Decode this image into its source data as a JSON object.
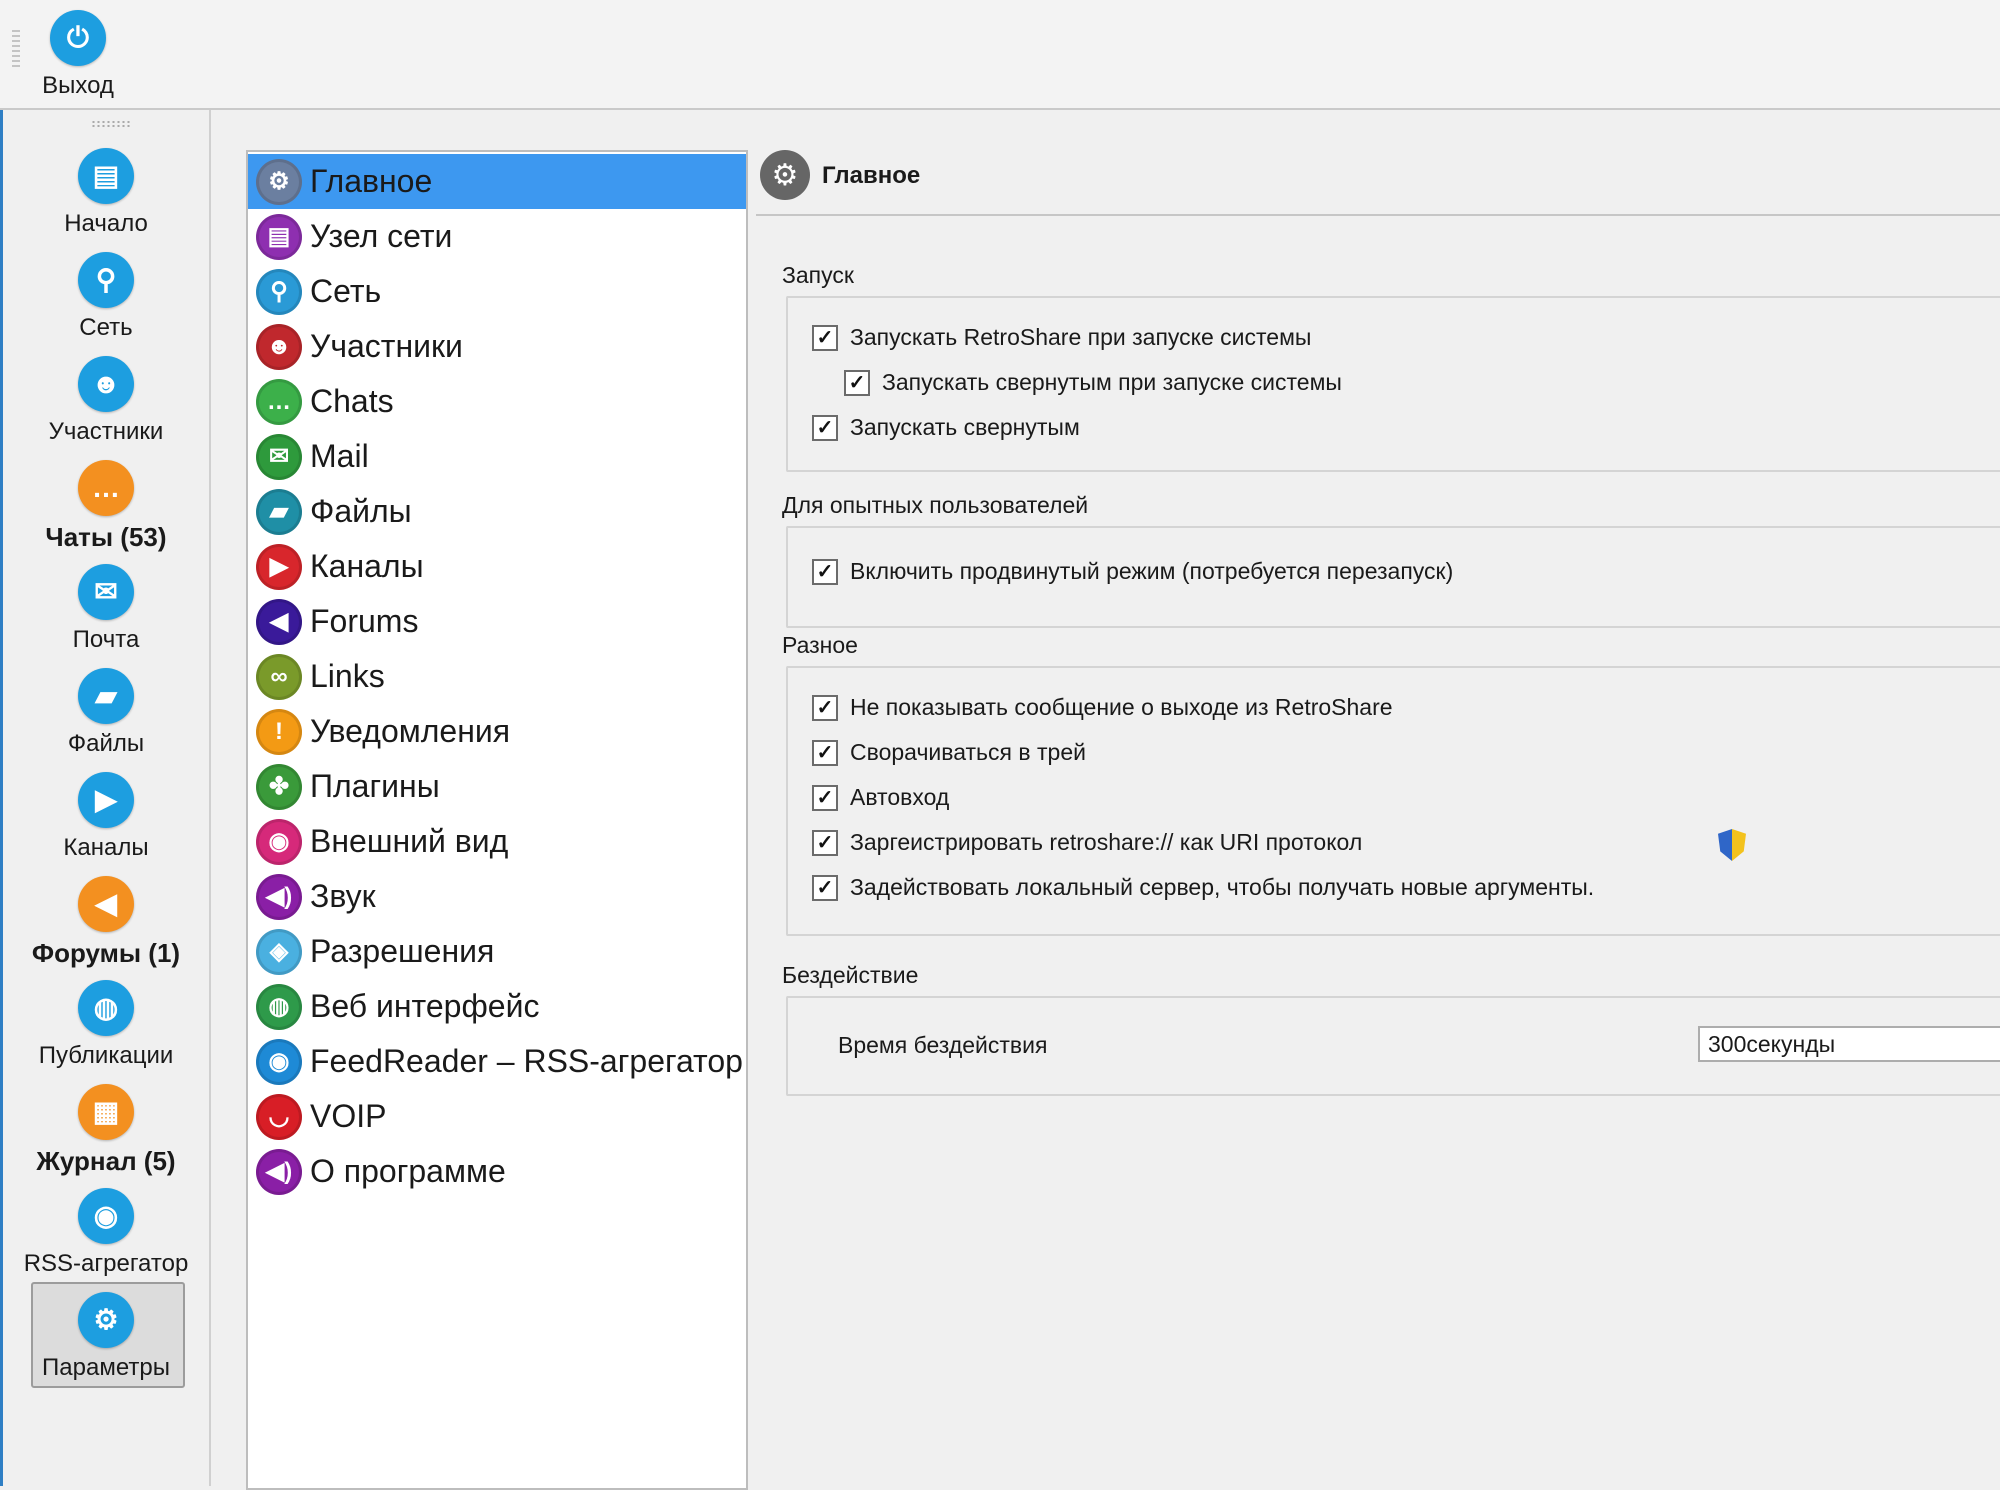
{
  "toolbar": {
    "exit_label": "Выход",
    "exit_icon": "power-icon"
  },
  "nav": {
    "items": [
      {
        "label": "Начало",
        "icon": "id-card-icon",
        "bold": false
      },
      {
        "label": "Сеть",
        "icon": "network-icon",
        "bold": false
      },
      {
        "label": "Участники",
        "icon": "people-icon",
        "bold": false
      },
      {
        "label": "Чаты (53)",
        "icon": "chat-icon",
        "bold": true
      },
      {
        "label": "Почта",
        "icon": "mail-icon",
        "bold": false
      },
      {
        "label": "Файлы",
        "icon": "files-icon",
        "bold": false
      },
      {
        "label": "Каналы",
        "icon": "channels-icon",
        "bold": false
      },
      {
        "label": "Форумы (1)",
        "icon": "forums-icon",
        "bold": true
      },
      {
        "label": "Публикации",
        "icon": "globe-icon",
        "bold": false
      },
      {
        "label": "Журнал (5)",
        "icon": "journal-icon",
        "bold": true
      },
      {
        "label": "RSS-агрегатор",
        "icon": "rss-icon",
        "bold": false
      },
      {
        "label": "Параметры",
        "icon": "gear-icon",
        "bold": false,
        "active": true
      }
    ]
  },
  "categories": [
    {
      "label": "Главное",
      "icon": "gear-icon",
      "color": "#6b7fa0",
      "selected": true
    },
    {
      "label": "Узел сети",
      "icon": "id-card-icon",
      "color": "#8e2fb0"
    },
    {
      "label": "Сеть",
      "icon": "network-icon",
      "color": "#2a9ad6"
    },
    {
      "label": "Участники",
      "icon": "people-icon",
      "color": "#c0282d"
    },
    {
      "label": "Chats",
      "icon": "chat-icon",
      "color": "#3cb04a"
    },
    {
      "label": "Mail",
      "icon": "mail-icon",
      "color": "#2e9a3c"
    },
    {
      "label": "Файлы",
      "icon": "files-icon",
      "color": "#1f8fa6"
    },
    {
      "label": "Каналы",
      "icon": "channels-icon",
      "color": "#d8262c"
    },
    {
      "label": "Forums",
      "icon": "forums-icon",
      "color": "#3a1a9a"
    },
    {
      "label": "Links",
      "icon": "links-icon",
      "color": "#7a9a2a"
    },
    {
      "label": "Уведомления",
      "icon": "alert-icon",
      "color": "#f39a14"
    },
    {
      "label": "Плагины",
      "icon": "puzzle-icon",
      "color": "#3a9a3a"
    },
    {
      "label": "Внешний вид",
      "icon": "eye-icon",
      "color": "#d6297a"
    },
    {
      "label": "Звук",
      "icon": "speaker-icon",
      "color": "#8a1fa6"
    },
    {
      "label": "Разрешения",
      "icon": "shield-icon",
      "color": "#4ab0e0"
    },
    {
      "label": "Веб интерфейс",
      "icon": "globe-icon",
      "color": "#2e9a4a"
    },
    {
      "label": "FeedReader – RSS-агрегатор",
      "icon": "rss-icon",
      "color": "#1e8ad6"
    },
    {
      "label": "VOIP",
      "icon": "lips-icon",
      "color": "#d81e26"
    },
    {
      "label": "О программе",
      "icon": "speaker-icon",
      "color": "#8a1fa6"
    }
  ],
  "pane": {
    "title": "Главное",
    "title_icon": "gear-icon",
    "groups": {
      "startup": {
        "title": "Запуск",
        "options": [
          {
            "label": "Запускать RetroShare при запуске системы",
            "checked": true
          },
          {
            "label": "Запускать свернутым при запуске системы",
            "checked": true
          },
          {
            "label": "Запускать свернутым",
            "checked": true
          }
        ]
      },
      "advanced": {
        "title": "Для опытных пользователей",
        "options": [
          {
            "label": "Включить продвинутый режим (потребуется перезапуск)",
            "checked": true
          }
        ]
      },
      "misc": {
        "title": "Разное",
        "options": [
          {
            "label": "Не показывать сообщение о выходе из RetroShare",
            "checked": true
          },
          {
            "label": "Сворачиваться в трей",
            "checked": true
          },
          {
            "label": "Автовход",
            "checked": true
          },
          {
            "label": "Заргеистрировать retroshare:// как URI протокол",
            "checked": true
          },
          {
            "label": "Задействовать локальный сервер, чтобы получать новые аргументы.",
            "checked": true
          }
        ]
      },
      "idle": {
        "title": "Бездействие",
        "field_label": "Время бездействия",
        "field_value": "300секунды"
      }
    }
  },
  "check_glyph": "✓"
}
